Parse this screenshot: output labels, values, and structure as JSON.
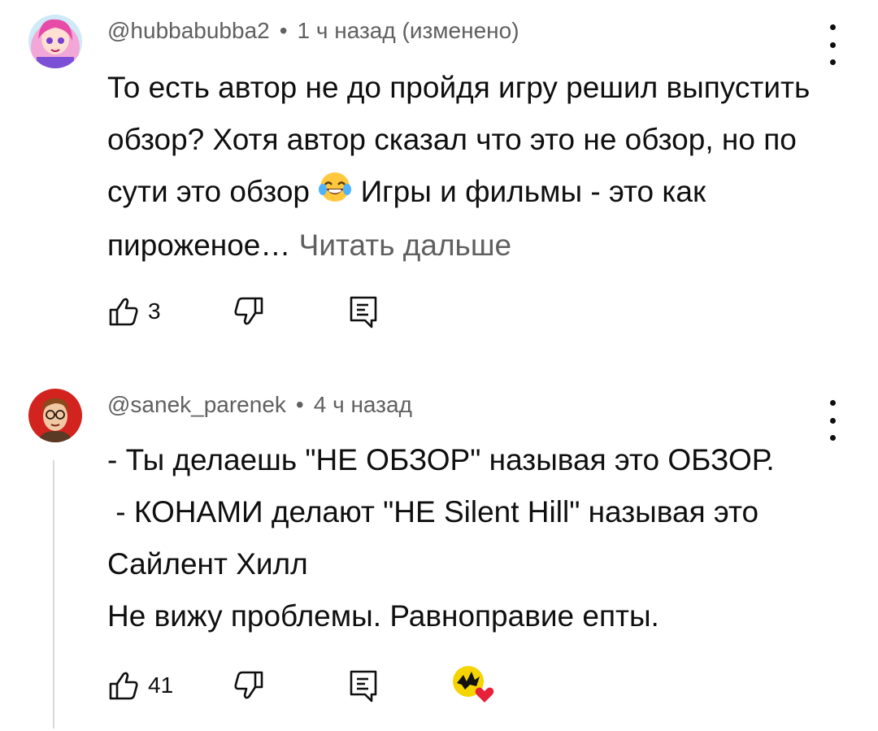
{
  "comments": [
    {
      "author": "@hubbabubba2",
      "time": "1 ч назад (изменено)",
      "text_before_emoji": "То есть автор не до пройдя игру решил выпустить обзор? Хотя автор сказал что это не обзор, но по сути это обзор",
      "text_after_emoji": " Игры и фильмы - это как пироженое…",
      "emoji": "face-with-tears-of-joy",
      "read_more": "Читать дальше",
      "likes": "3"
    },
    {
      "author": "@sanek_parenek",
      "time": "4 ч назад",
      "lines": [
        "- Ты делаешь \"НЕ ОБЗОР\" называя это ОБЗОР.",
        " - КОНАМИ делают \"НЕ Silent Hill\" называя это Сайлент Хилл",
        "Не вижу проблемы. Равноправие епты."
      ],
      "likes": "41",
      "creator_heart": true
    }
  ],
  "colors": {
    "text": "#0f0f0f",
    "secondary": "#606060",
    "heart": "#e8213b"
  },
  "icons": {
    "like": "thumb-up-icon",
    "dislike": "thumb-down-icon",
    "reply": "reply-icon",
    "more": "more-vertical-icon"
  }
}
